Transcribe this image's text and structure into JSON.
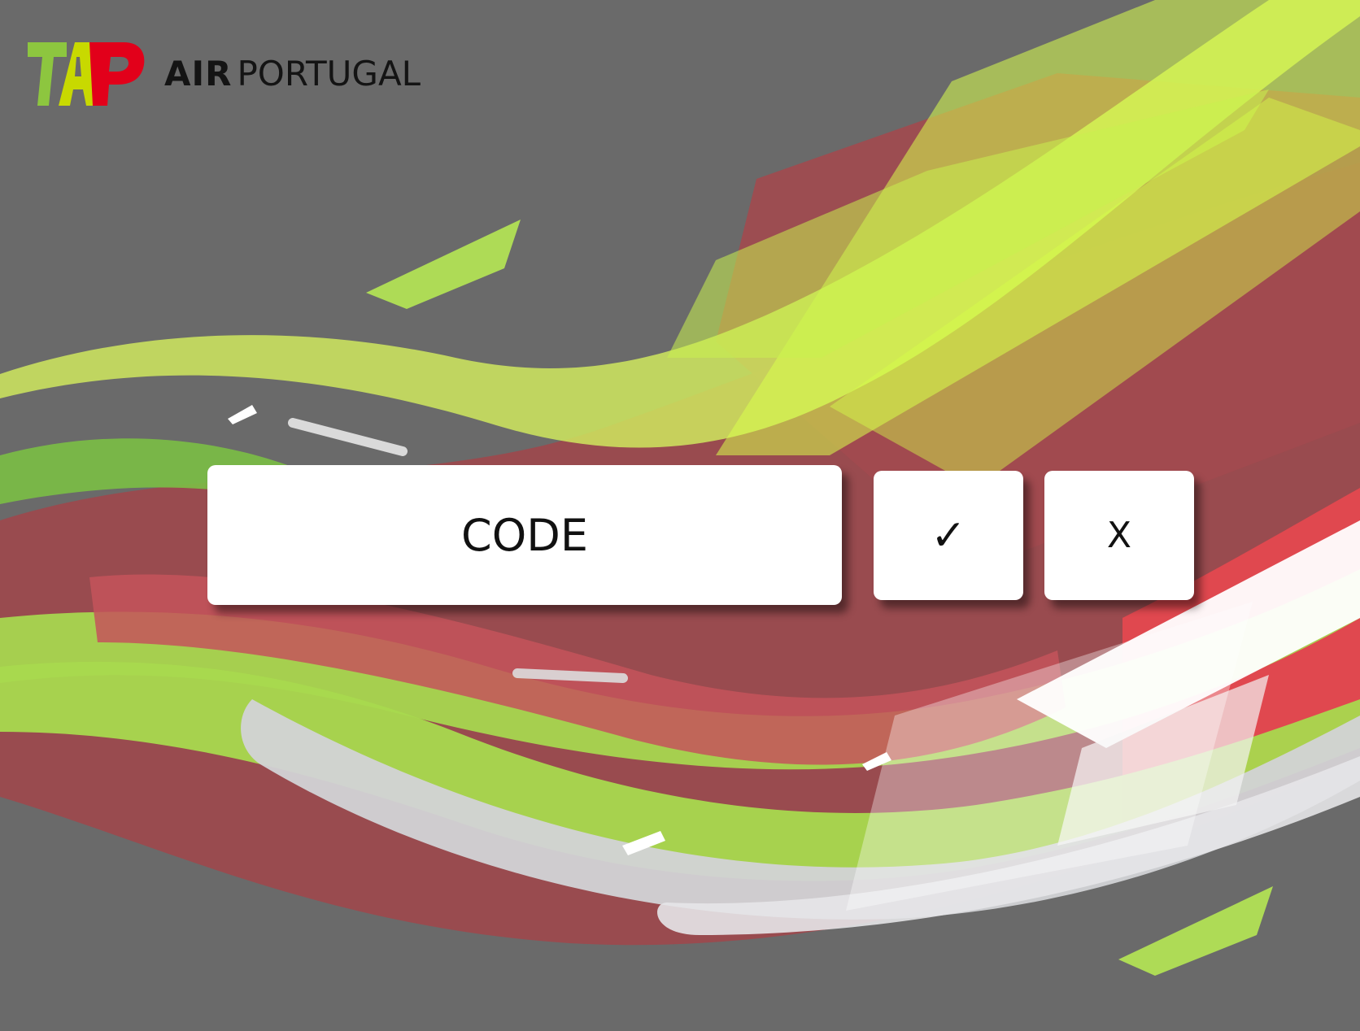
{
  "brand": {
    "logo_icon": "tap-logo-icon",
    "name_bold": "AIR",
    "name_regular": "PORTUGAL",
    "colors": {
      "green": "#8dc63f",
      "red": "#e2001a",
      "lime": "#d4ff4a"
    }
  },
  "dialog": {
    "code_label": "CODE",
    "confirm_label": "✓",
    "cancel_label": "X"
  },
  "theme": {
    "background": "#6a6a6a",
    "button_background": "#ffffff",
    "text_color": "#111111"
  }
}
